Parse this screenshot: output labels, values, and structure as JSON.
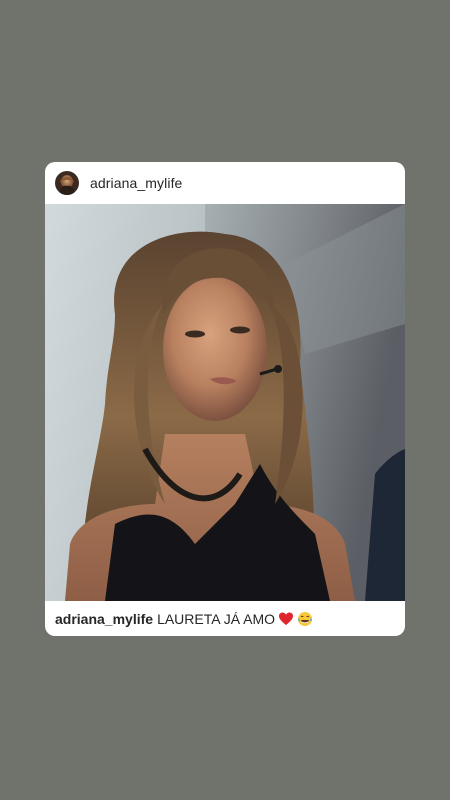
{
  "post": {
    "username": "adriana_mylife",
    "caption": {
      "username": "adriana_mylife",
      "text": "LAURETA JÁ AMO",
      "emojis": [
        "heart-emoji",
        "tears-of-joy-emoji"
      ]
    }
  },
  "colors": {
    "background": "#70726c",
    "card": "#ffffff",
    "text": "#262626",
    "heart": "#e0242e"
  }
}
